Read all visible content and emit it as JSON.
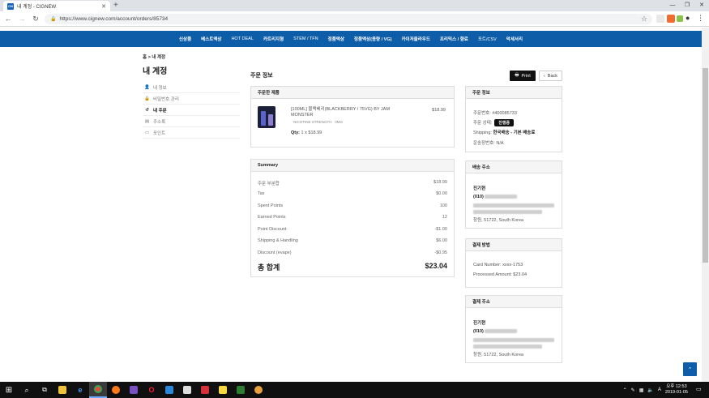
{
  "browser": {
    "tab_title": "내 계정 - CIGNEW",
    "tab_favicon": "CN",
    "url": "https://www.cignew.com/account/orders/85734"
  },
  "nav": {
    "items": [
      "신상품",
      "베스트액상",
      "HOT DEAL",
      "카트리지형",
      "STEM / TFN",
      "정품액상",
      "정품액상(용량 / VG)",
      "카이저클라우드",
      "프리믹스 / 향료",
      "포트/CSV",
      "악세서리"
    ]
  },
  "breadcrumb": {
    "home": "홈",
    "sep": ">",
    "current": "내 계정"
  },
  "page_title": "내 계정",
  "sidemenu": [
    {
      "label": "내 정보",
      "icon": "user-icon",
      "glyph": "👤"
    },
    {
      "label": "비밀번호 관리",
      "icon": "lock-icon",
      "glyph": "🔒"
    },
    {
      "label": "내 주문",
      "icon": "history-icon",
      "glyph": "↺"
    },
    {
      "label": "주소록",
      "icon": "addressbook-icon",
      "glyph": "▤"
    },
    {
      "label": "포인트",
      "icon": "points-icon",
      "glyph": "▭"
    }
  ],
  "order": {
    "section_title": "주문 정보",
    "print_label": "Print",
    "back_label": "Back",
    "ordered_header": "주문한 제품",
    "product": {
      "name": "[100ML] 블랙베리(BLACKBERRY / 75VG) BY JAM MONSTER",
      "option_label": "NICOTINE STRENGTH",
      "option_value": "0MG",
      "price": "$18.99",
      "qty_label": "Qty:",
      "qty_value": "1 x $18.99"
    },
    "summary": {
      "header": "Summary",
      "rows": [
        {
          "label": "주문 부분합",
          "value": "$18.99"
        },
        {
          "label": "Tax",
          "value": "$0.00"
        },
        {
          "label": "Spent Points",
          "value": "100"
        },
        {
          "label": "Earned Points",
          "value": "12"
        },
        {
          "label": "Point Discount",
          "value": "-$1.00"
        },
        {
          "label": "Shipping & Handling",
          "value": "$6.00"
        },
        {
          "label": "Discount (evape)",
          "value": "-$0.95"
        }
      ],
      "total_label": "총 합계",
      "total_value": "$23.04"
    }
  },
  "info": {
    "header": "주문 정보",
    "order_no_label": "주문번호:",
    "order_no": "#400085733",
    "status_label": "주문 상태:",
    "status": "진행중",
    "shipping_label": "Shipping:",
    "shipping": "한국배송 - 기본 배송료",
    "tracking_label": "운송장번호:",
    "tracking": "N/A"
  },
  "ship_addr": {
    "header": "배송 주소",
    "name": "진기현",
    "phone_prefix": "(010)",
    "city": "창원, 51722, South Korea"
  },
  "payment": {
    "header": "결제 방법",
    "card_label": "Card Number:",
    "card": "xxxx-1753",
    "amount_label": "Processed Amount:",
    "amount": "$23.04"
  },
  "bill_addr": {
    "header": "결제 주소",
    "name": "진기현",
    "phone_prefix": "(010)",
    "city": "창원, 51722, South Korea"
  },
  "taskbar": {
    "time": "오후 12:53",
    "date": "2019-01-05"
  },
  "colors": {
    "brand": "#0d5da8",
    "dark": "#111111"
  }
}
